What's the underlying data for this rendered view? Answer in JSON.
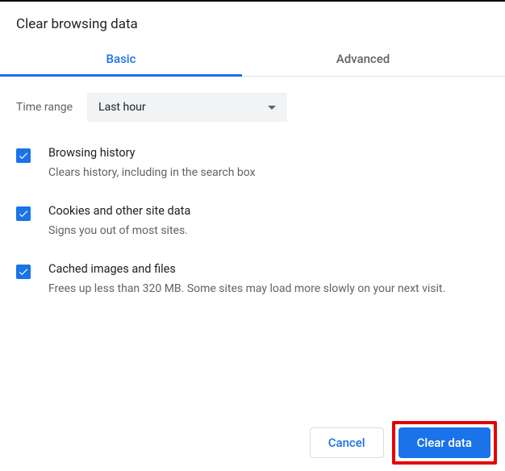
{
  "title": "Clear browsing data",
  "tabs": {
    "basic": "Basic",
    "advanced": "Advanced"
  },
  "time": {
    "label": "Time range",
    "value": "Last hour"
  },
  "options": [
    {
      "title": "Browsing history",
      "desc": "Clears history, including in the search box"
    },
    {
      "title": "Cookies and other site data",
      "desc": "Signs you out of most sites."
    },
    {
      "title": "Cached images and files",
      "desc": "Frees up less than 320 MB. Some sites may load more slowly on your next visit."
    }
  ],
  "buttons": {
    "cancel": "Cancel",
    "clear": "Clear data"
  }
}
